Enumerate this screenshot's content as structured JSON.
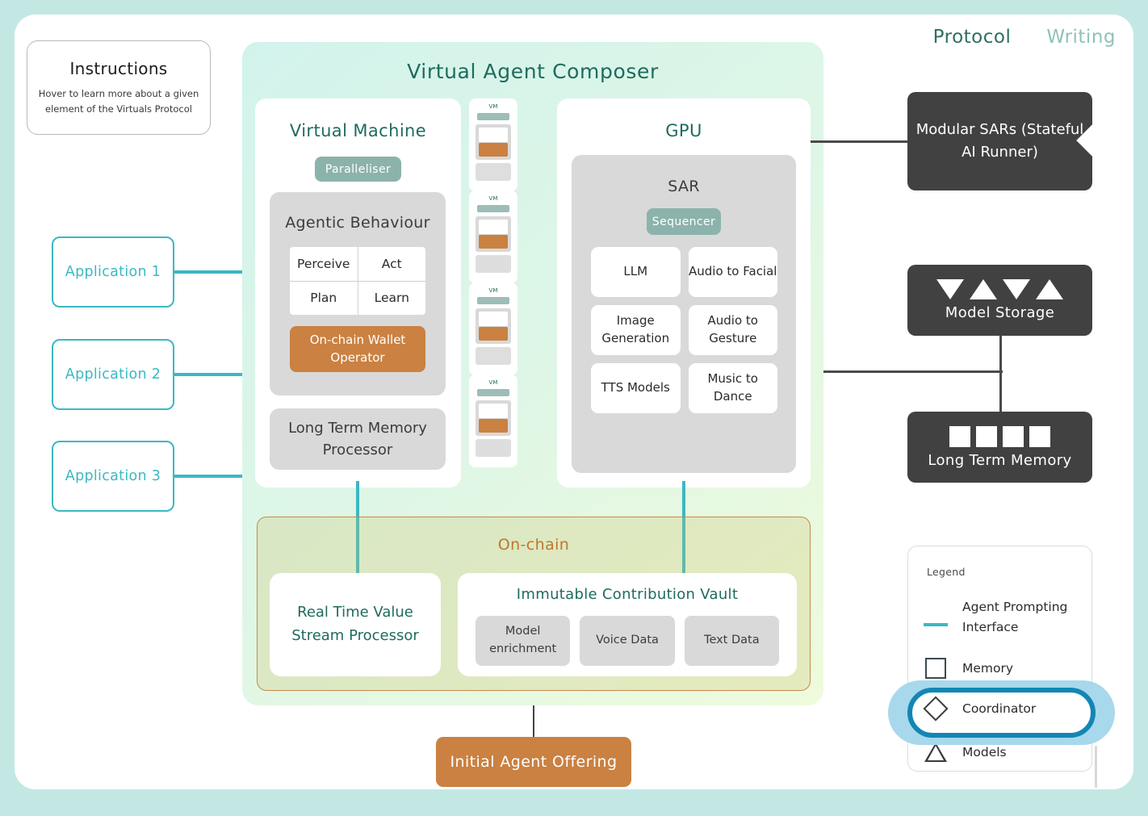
{
  "nav": {
    "items": [
      {
        "label": "Protocol",
        "state": "active"
      },
      {
        "label": "Writing",
        "state": "inactive"
      }
    ]
  },
  "instructions": {
    "title": "Instructions",
    "body": "Hover to learn more about a given element of the Virtuals Protocol"
  },
  "applications": [
    {
      "label": "Application 1"
    },
    {
      "label": "Application 2"
    },
    {
      "label": "Application 3"
    }
  ],
  "composer": {
    "title": "Virtual Agent Composer",
    "virtual_machine": {
      "title": "Virtual Machine",
      "paralleliser_label": "Paralleliser",
      "agentic_behaviour": {
        "title": "Agentic Behaviour",
        "cells": [
          "Perceive",
          "Act",
          "Plan",
          "Learn"
        ],
        "wallet_operator": "On-chain Wallet Operator"
      },
      "long_term_memory_processor": "Long Term Memory Processor"
    },
    "mini_vms": [
      {
        "label": "VM"
      },
      {
        "label": "VM"
      },
      {
        "label": "VM"
      },
      {
        "label": "VM"
      }
    ],
    "gpu": {
      "title": "GPU",
      "sar": {
        "title": "SAR",
        "sequencer_label": "Sequencer",
        "models": [
          "LLM",
          "Audio to Facial",
          "Image Generation",
          "Audio to Gesture",
          "TTS Models",
          "Music to Dance"
        ]
      }
    },
    "onchain": {
      "title": "On-chain",
      "real_time_value_stream_processor": "Real Time Value Stream Processor",
      "vault": {
        "title": "Immutable Contribution Vault",
        "items": [
          "Model enrichment",
          "Voice Data",
          "Text Data"
        ]
      }
    }
  },
  "initial_agent_offering": {
    "label": "Initial Agent Offering"
  },
  "right_column": {
    "modular_sars": {
      "label": "Modular SARs (Stateful AI Runner)"
    },
    "model_storage": {
      "label": "Model Storage"
    },
    "long_term_memory": {
      "label": "Long Term Memory"
    }
  },
  "legend": {
    "title": "Legend",
    "items": [
      {
        "icon": "line-icon",
        "label": "Agent Prompting Interface"
      },
      {
        "icon": "square-icon",
        "label": "Memory"
      },
      {
        "icon": "diamond-icon",
        "label": "Coordinator",
        "highlighted": true
      },
      {
        "icon": "triangle-icon",
        "label": "Models"
      }
    ]
  },
  "colors": {
    "page_background": "#c3e8e4",
    "card_background": "#ffffff",
    "teal_accent": "#3bb8c3",
    "deep_teal": "#1f6b5e",
    "orange": "#ca8141",
    "onchain_border": "#c68a4d",
    "dark_box": "#414141",
    "pill_green": "#8cb3ab",
    "gray_box": "#d9d9d9",
    "highlight_ring": "#1386b5",
    "highlight_glow": "#a8d8ec"
  }
}
